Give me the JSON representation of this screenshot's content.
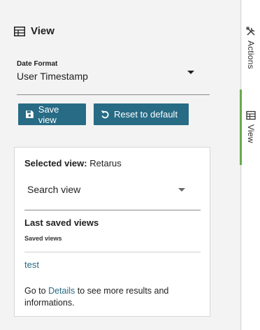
{
  "panel": {
    "title": "View",
    "icon": "table-icon"
  },
  "date_format": {
    "label": "Date Format",
    "value": "User Timestamp"
  },
  "buttons": {
    "save_label": "Save view",
    "reset_label": "Reset to default"
  },
  "selected_view": {
    "key": "Selected view:",
    "value": "Retarus",
    "search_value": "Search view"
  },
  "last_saved": {
    "title": "Last saved views",
    "subtitle": "Saved views",
    "items": [
      "test"
    ]
  },
  "note": {
    "prefix": "Go to",
    "link": "Details",
    "suffix": "to see more results and informations."
  },
  "rail": {
    "tabs": [
      {
        "label": "Actions",
        "icon": "tools-icon",
        "active": false
      },
      {
        "label": "View",
        "icon": "table-icon",
        "active": true
      }
    ]
  },
  "colors": {
    "primary": "#276b85",
    "active_tab": "#6aa84f",
    "panel_bg": "#f3f3f3"
  }
}
